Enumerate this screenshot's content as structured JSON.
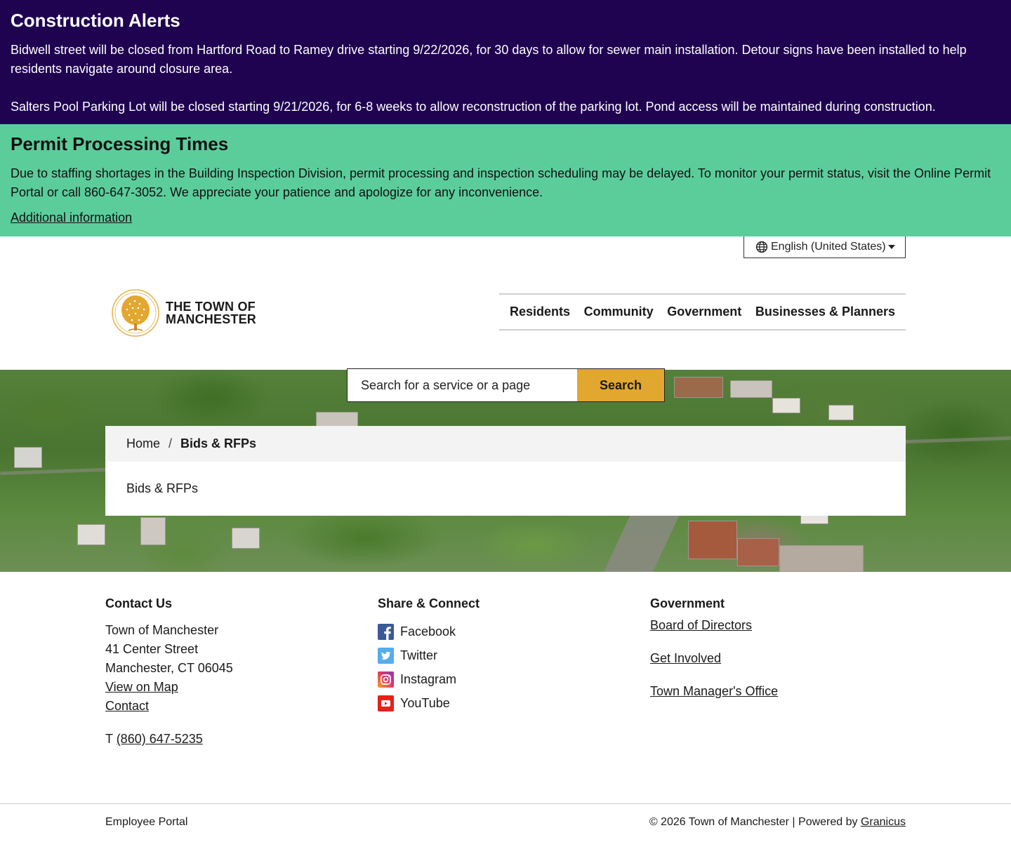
{
  "alerts": {
    "construction": {
      "title": "Construction Alerts",
      "items": [
        "Bidwell street will be closed from Hartford Road to Ramey drive starting 9/22/2026, for 30 days to allow for sewer main installation. Detour signs have been installed to help residents navigate around closure area.",
        "Salters Pool Parking Lot will be closed starting 9/21/2026, for 6-8 weeks to allow reconstruction of the parking lot. Pond access will be maintained during construction."
      ],
      "background": "#1f0250"
    },
    "permit": {
      "title": "Permit Processing Times",
      "body": "Due to staffing shortages in the Building Inspection Division, permit processing and inspection scheduling may be delayed. To monitor your permit status, visit the Online Permit Portal or call 860-647-3052. We appreciate your patience and apologize for any inconvenience.",
      "link_label": "Additional information",
      "background": "#5bcd9b"
    }
  },
  "language": {
    "selected": "English (United States)",
    "icon": "globe-icon"
  },
  "header": {
    "logo_line1": "THE TOWN OF",
    "logo_line2": "MANCHESTER",
    "logo_icon": "tree-seal-icon",
    "nav": [
      "Residents",
      "Community",
      "Government",
      "Businesses & Planners"
    ]
  },
  "search": {
    "placeholder": "Search for a service or a page",
    "button_label": "Search",
    "accent": "#e2a72f"
  },
  "breadcrumb": {
    "home": "Home",
    "separator": "/",
    "current": "Bids & RFPs"
  },
  "page": {
    "title": "Bids & RFPs"
  },
  "footer": {
    "contact": {
      "heading": "Contact Us",
      "org": "Town of Manchester",
      "street": "41 Center Street",
      "city": "Manchester, CT 06045",
      "map_link": "View on Map",
      "contact_link": "Contact",
      "phone_prefix": "T",
      "phone": "(860) 647-5235"
    },
    "share": {
      "heading": "Share & Connect",
      "items": [
        {
          "label": "Facebook",
          "icon": "facebook-icon",
          "color": "#3b5998"
        },
        {
          "label": "Twitter",
          "icon": "twitter-icon",
          "color": "#55acee"
        },
        {
          "label": "Instagram",
          "icon": "instagram-icon",
          "color": "#e1306c"
        },
        {
          "label": "YouTube",
          "icon": "youtube-icon",
          "color": "#e62117"
        }
      ]
    },
    "government": {
      "heading": "Government",
      "links": [
        "Board of Directors",
        "Get Involved",
        "Town Manager's Office"
      ]
    },
    "bottom": {
      "employee_portal": "Employee Portal",
      "copyright": "© 2026 Town of Manchester | Powered by",
      "powered_link": "Granicus"
    }
  }
}
